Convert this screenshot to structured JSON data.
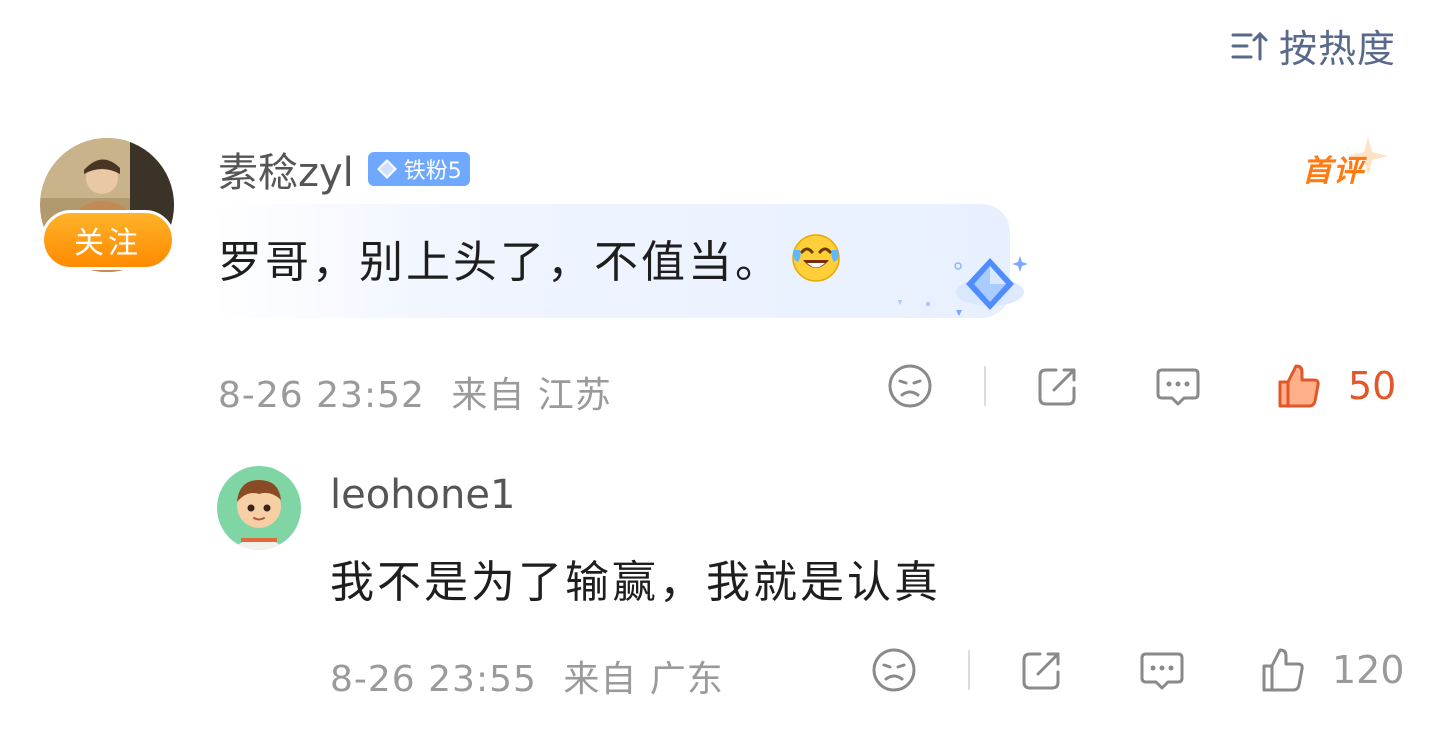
{
  "sort": {
    "label": "按热度",
    "icon": "sort-icon"
  },
  "main_comment": {
    "follow_label": "关注",
    "username": "素稔zyl",
    "fan_badge": {
      "label": "铁粉5",
      "color": "#6ea8ff"
    },
    "first_badge": "首评",
    "text": "罗哥，别上头了，不值当。",
    "emoji": "laughing-crying-emoji",
    "time": "8-26 23:52",
    "location": "来自 江苏",
    "like_count": "50",
    "liked": true
  },
  "reply": {
    "username": "leohone1",
    "text": "我不是为了输赢，我就是认真",
    "time": "8-26 23:55",
    "location": "来自 广东",
    "like_count": "120",
    "liked": false
  },
  "colors": {
    "accent_orange": "#ff8a00",
    "like_active": "#e2572a",
    "meta_gray": "#9a9a9a",
    "link_blue": "#58698a"
  }
}
